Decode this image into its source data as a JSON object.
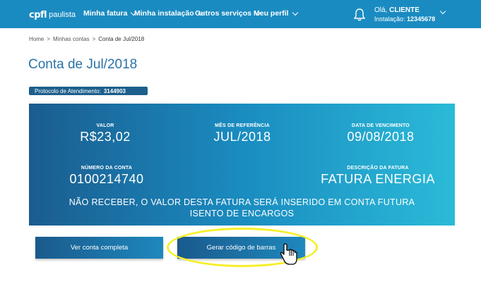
{
  "header": {
    "logo_mark": "cpfl",
    "logo_name": "paulista",
    "nav": [
      {
        "label": "Minha fatura"
      },
      {
        "label": "Minha instalação"
      },
      {
        "label": "Outros serviços"
      },
      {
        "label": "Meu perfil"
      }
    ],
    "user": {
      "greeting_prefix": "Olá,",
      "name": "CLIENTE",
      "installation_prefix": "Instalação:",
      "installation_number": "12345678"
    }
  },
  "breadcrumb": {
    "items": [
      "Home",
      "Minhas contas",
      "Conta de Jul/2018"
    ],
    "separator": ">"
  },
  "page_title": "Conta de Jul/2018",
  "protocol": {
    "label": "Protocolo de Atendimento:",
    "value": "3144903"
  },
  "invoice": {
    "valor_label": "VALOR",
    "valor": "R$23,02",
    "mes_label": "MÊS DE REFERÊNCIA",
    "mes": "JUL/2018",
    "vencimento_label": "DATA DE VENCIMENTO",
    "vencimento": "09/08/2018",
    "numero_label": "NÚMERO DA CONTA",
    "numero": "0100214740",
    "descricao_label": "DESCRIÇÃO DA FATURA",
    "descricao": "FATURA ENERGIA",
    "notice_line1": "NÃO RECEBER, O VALOR DESTA FATURA SERÁ INSERIDO EM CONTA FUTURA",
    "notice_line2": "ISENTO DE ENCARGOS"
  },
  "actions": {
    "view_full": "Ver conta completa",
    "barcode": "Gerar código de barras"
  },
  "colors": {
    "header_bg": "#1a8bc1",
    "title": "#2a72a8",
    "card_start": "#1b5c8f",
    "card_end": "#2bbad8",
    "highlight": "#f7ef2a"
  }
}
